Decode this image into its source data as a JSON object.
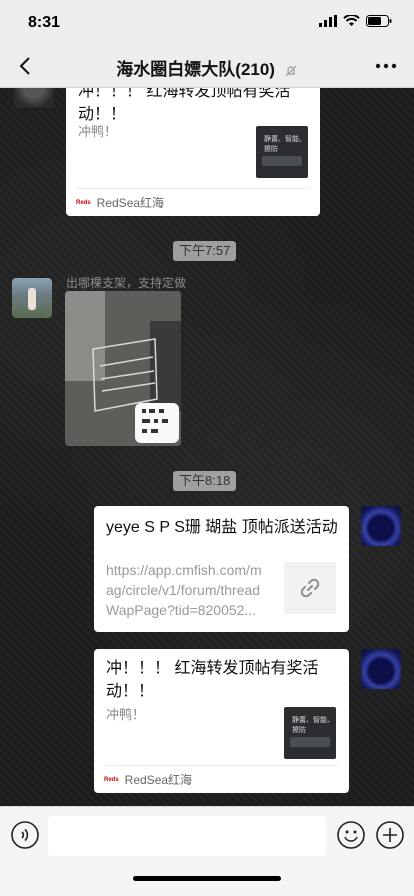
{
  "status": {
    "time": "8:31"
  },
  "nav": {
    "title": "海水圈白嫖大队(210)"
  },
  "messages": {
    "card1": {
      "title": "冲！！！ 红海转发顶帖有奖活动！！",
      "desc": "冲鸭！",
      "source": "RedSea红海"
    },
    "time1": "下午7:57",
    "msg2": {
      "sender": "出哪棵支架，支持定做"
    },
    "time2": "下午8:18",
    "link1": {
      "title": "yeye S P S珊 瑚盐 顶帖派送活动",
      "url": "https://app.cmfish.com/mag/circle/v1/forum/threadWapPage?tid=820052..."
    },
    "card2": {
      "title": "冲！！！ 红海转发顶帖有奖活动！！",
      "desc": "冲鸭！",
      "source": "RedSea红海"
    }
  },
  "thumb": {
    "tagline": "静置、智能、擦防"
  },
  "colors": {
    "navBg": "#ededed",
    "bubble": "#ffffff",
    "inputBar": "#f5f5f5"
  }
}
